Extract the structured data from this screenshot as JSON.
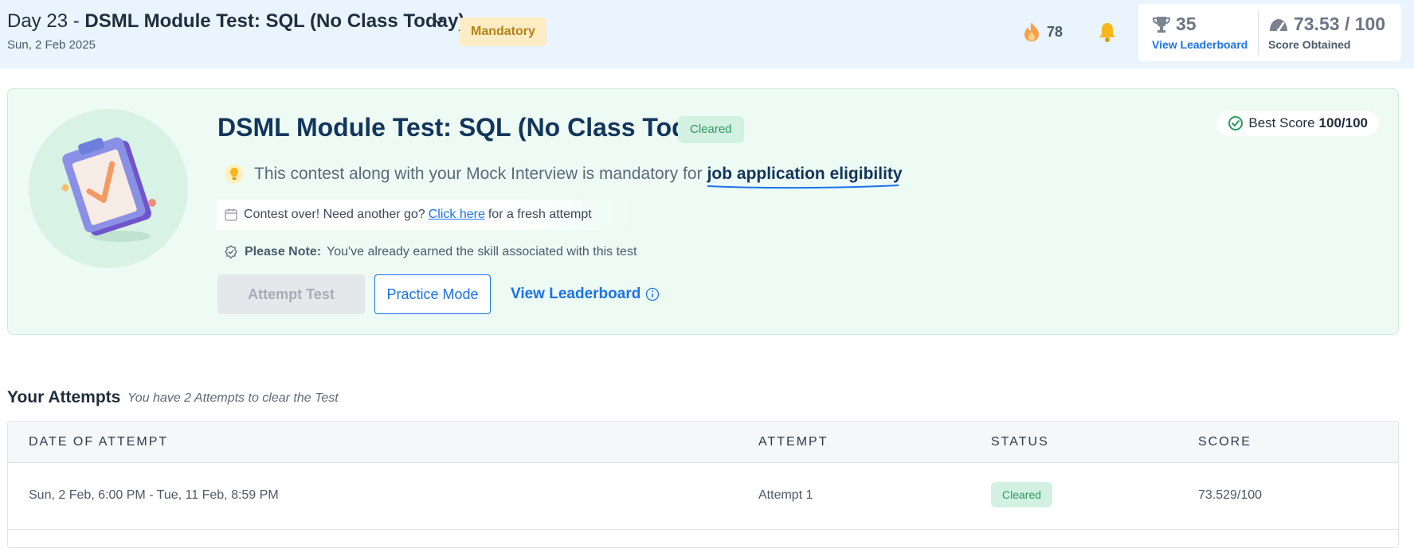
{
  "header": {
    "day_prefix": "Day 23 - ",
    "title": "DSML Module Test: SQL (No Class Today)",
    "date": "Sun, 2 Feb 2025",
    "badge": "Mandatory",
    "streak_count": "78",
    "rank": "35",
    "rank_link": "View Leaderboard",
    "score": "73.53 / 100",
    "score_label": "Score Obtained"
  },
  "contest": {
    "title": "DSML Module Test: SQL (No Class Today)",
    "status": "Cleared",
    "best_score_label": "Best Score",
    "best_score_value": "100/100",
    "mandatory_text": "This contest along with your Mock Interview is mandatory for",
    "mandatory_emphasis": "job application eligibility",
    "retry_before": "Contest over! Need another go?",
    "retry_link": "Click here",
    "retry_after": "for a fresh attempt",
    "note_label": "Please Note:",
    "note_text": "You've already earned the skill associated with this test",
    "attempt_button": "Attempt Test",
    "practice_button": "Practice Mode",
    "leaderboard_link": "View Leaderboard"
  },
  "attempts": {
    "title": "Your Attempts",
    "subtitle": "You have 2 Attempts to clear the Test",
    "columns": [
      "DATE OF ATTEMPT",
      "ATTEMPT",
      "STATUS",
      "SCORE"
    ],
    "rows": [
      {
        "date": "Sun, 2 Feb, 6:00 PM - Tue, 11 Feb, 8:59 PM",
        "attempt": "Attempt 1",
        "status": "Cleared",
        "score": "73.529/100"
      }
    ]
  },
  "colors": {
    "header_bg": "#e9f4fe",
    "accent": "#1a73e8",
    "cleared": "#2c9a5e",
    "mandatory": "#b58316"
  }
}
